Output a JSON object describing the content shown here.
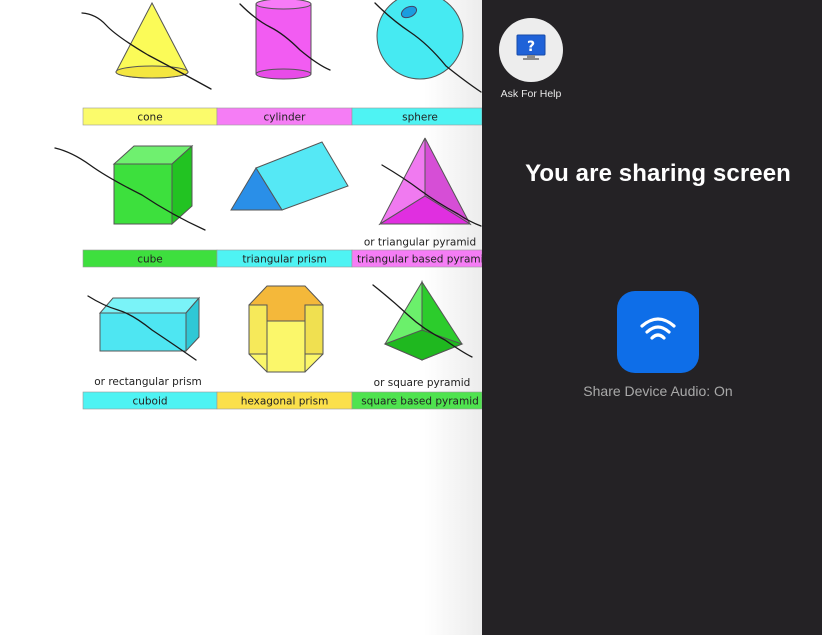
{
  "shapes": {
    "row1": {
      "labels": [
        "cone",
        "cylinder",
        "sphere"
      ],
      "colors": [
        "#fbfb6b",
        "#f57df5",
        "#4ef3f3"
      ]
    },
    "row2": {
      "labels": [
        "cube",
        "triangular prism",
        "triangular based pyramid"
      ],
      "alt_caption": "or triangular pyramid",
      "colors": [
        "#3edf3e",
        "#4ef3f3",
        "#f57df5"
      ]
    },
    "row3": {
      "labels": [
        "cuboid",
        "hexagonal prism",
        "square based pyramid"
      ],
      "alt_captions": [
        "or rectangular prism",
        "or square pyramid"
      ],
      "colors": [
        "#4ef3f3",
        "#fbe04a",
        "#4fe34f"
      ]
    }
  },
  "panel": {
    "help_label": "Ask For Help",
    "title": "You are sharing screen",
    "audio_label": "Share Device Audio: On",
    "background": "#242225",
    "audio_button_color": "#0e6ee8"
  },
  "icons": {
    "help": "question-monitor-icon",
    "audio": "wifi-signal-icon"
  }
}
